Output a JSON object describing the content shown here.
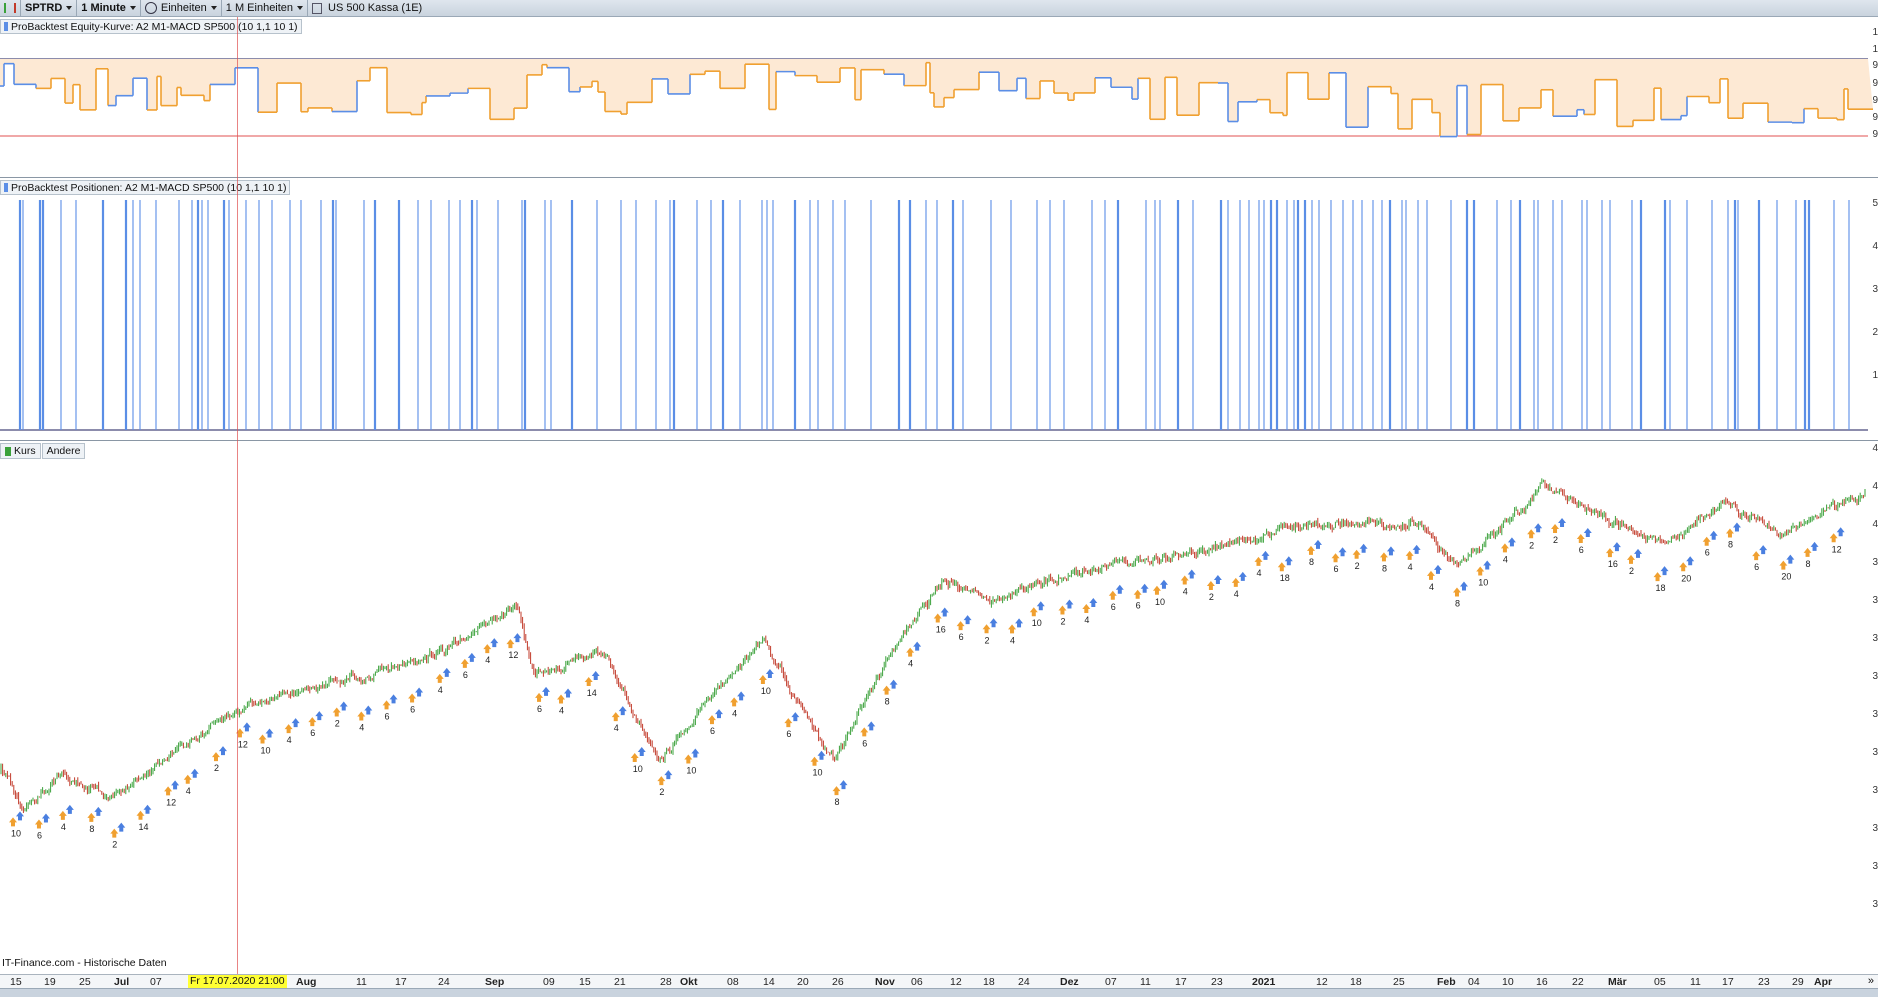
{
  "toolbar": {
    "symbol": "SPTRD",
    "interval": "1 Minute",
    "units_mode": "Einheiten",
    "units_count": "1 M Einheiten",
    "instrument": "US 500 Kassa (1E)"
  },
  "panels": {
    "equity_title": "ProBacktest Equity-Kurve: A2 M1-MACD SP500 (10 1,1 10 1)",
    "positions_title": "ProBacktest Positionen: A2 M1-MACD SP500 (10 1,1 10 1)",
    "price_tabs": [
      "Kurs",
      "Andere"
    ]
  },
  "crosshair_date": "Fr 17.07.2020 21:00",
  "source_label": "IT-Finance.com - Historische Daten",
  "x_axis_labels": [
    {
      "t": "15",
      "b": false
    },
    {
      "t": "19",
      "b": false
    },
    {
      "t": "25",
      "b": false
    },
    {
      "t": "Jul",
      "b": true
    },
    {
      "t": "07",
      "b": false
    },
    {
      "t": "Aug",
      "b": true
    },
    {
      "t": "11",
      "b": false
    },
    {
      "t": "17",
      "b": false
    },
    {
      "t": "24",
      "b": false
    },
    {
      "t": "Sep",
      "b": true
    },
    {
      "t": "09",
      "b": false
    },
    {
      "t": "15",
      "b": false
    },
    {
      "t": "21",
      "b": false
    },
    {
      "t": "28",
      "b": false
    },
    {
      "t": "Okt",
      "b": true
    },
    {
      "t": "08",
      "b": false
    },
    {
      "t": "14",
      "b": false
    },
    {
      "t": "20",
      "b": false
    },
    {
      "t": "26",
      "b": false
    },
    {
      "t": "Nov",
      "b": true
    },
    {
      "t": "06",
      "b": false
    },
    {
      "t": "12",
      "b": false
    },
    {
      "t": "18",
      "b": false
    },
    {
      "t": "24",
      "b": false
    },
    {
      "t": "Dez",
      "b": true
    },
    {
      "t": "07",
      "b": false
    },
    {
      "t": "11",
      "b": false
    },
    {
      "t": "17",
      "b": false
    },
    {
      "t": "23",
      "b": false
    },
    {
      "t": "2021",
      "b": true
    },
    {
      "t": "12",
      "b": false
    },
    {
      "t": "18",
      "b": false
    },
    {
      "t": "25",
      "b": false
    },
    {
      "t": "Feb",
      "b": true
    },
    {
      "t": "04",
      "b": false
    },
    {
      "t": "10",
      "b": false
    },
    {
      "t": "16",
      "b": false
    },
    {
      "t": "22",
      "b": false
    },
    {
      "t": "Mär",
      "b": true
    },
    {
      "t": "05",
      "b": false
    },
    {
      "t": "11",
      "b": false
    },
    {
      "t": "17",
      "b": false
    },
    {
      "t": "23",
      "b": false
    },
    {
      "t": "29",
      "b": false
    },
    {
      "t": "Apr",
      "b": true
    }
  ],
  "equity_y_ticks": [
    "1",
    "1",
    "9",
    "9",
    "9",
    "9",
    "9"
  ],
  "positions_y_ticks": [
    "5",
    "4",
    "3",
    "2",
    "1"
  ],
  "price_y_ticks": [
    "4",
    "4",
    "4",
    "3",
    "3",
    "3",
    "3",
    "3",
    "3",
    "3",
    "3",
    "3",
    "3"
  ],
  "trade_labels": [
    "10",
    "6",
    "4",
    "8",
    "2",
    "14",
    "12",
    "4",
    "2",
    "12",
    "10",
    "4",
    "6",
    "2",
    "4",
    "6",
    "6",
    "4",
    "6",
    "4",
    "12",
    "6",
    "4",
    "14",
    "4",
    "10",
    "2",
    "10",
    "6",
    "4",
    "10",
    "6",
    "10",
    "8",
    "6",
    "8",
    "4",
    "16",
    "6",
    "2",
    "4",
    "10",
    "2",
    "4",
    "6",
    "6",
    "10",
    "4",
    "2",
    "4",
    "4",
    "18",
    "8",
    "6",
    "2",
    "8",
    "4",
    "4",
    "8",
    "10",
    "4",
    "2",
    "2",
    "6",
    "16",
    "2",
    "18",
    "20",
    "6",
    "8",
    "6",
    "20",
    "8",
    "12"
  ],
  "colors": {
    "equity_up": "#5b8ee6",
    "equity_down": "#f0a030",
    "equity_fill": "#fde9d4",
    "position_bars": "#5b8ee6",
    "candle_up": "#3aa13a",
    "candle_down": "#c23a2a",
    "crosshair": "#e05050",
    "arrow_orange": "#f0a030",
    "arrow_blue": "#4a7fe0"
  }
}
